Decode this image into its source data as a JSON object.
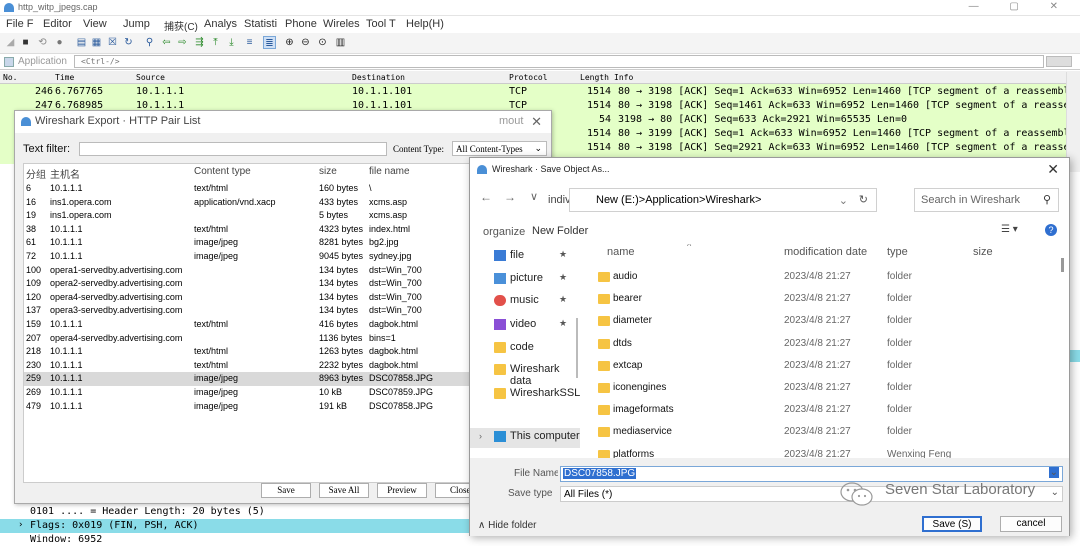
{
  "main": {
    "title": "http_witp_jpegs.cap",
    "menu": [
      "File F",
      "Editor",
      "View",
      "Jump",
      "捕获(C)",
      "Analys",
      "Statisti",
      "Phone",
      "Wireles",
      "Tool T",
      "Help(H)"
    ],
    "filter_label": "Application",
    "filter_placeholder": "<Ctrl-/>",
    "columns": [
      "No.",
      "Time",
      "Source",
      "Destination",
      "Protocol",
      "Length",
      "Info"
    ],
    "packets": [
      {
        "no": "246",
        "time": "6.767765",
        "src": "10.1.1.1",
        "dst": "10.1.1.101",
        "proto": "TCP",
        "len": "1514",
        "info": "80 → 3198 [ACK] Seq=1 Ack=633 Win=6952 Len=1460 [TCP segment of a reassembled PDU]"
      },
      {
        "no": "247",
        "time": "6.768985",
        "src": "10.1.1.1",
        "dst": "10.1.1.101",
        "proto": "TCP",
        "len": "1514",
        "info": "80 → 3198 [ACK] Seq=1461 Ack=633 Win=6952 Len=1460 [TCP segment of a reassembled PDU]"
      },
      {
        "no": "",
        "time": "",
        "src": "",
        "dst": "",
        "proto": "",
        "len": "54",
        "info": "3198 → 80 [ACK] Seq=633 Ack=2921 Win=65535 Len=0"
      },
      {
        "no": "",
        "time": "",
        "src": "",
        "dst": "",
        "proto": "",
        "len": "1514",
        "info": "80 → 3199 [ACK] Seq=1 Ack=633 Win=6952 Len=1460 [TCP segment of a reassembled PDU]"
      },
      {
        "no": "",
        "time": "",
        "src": "",
        "dst": "",
        "proto": "",
        "len": "1514",
        "info": "80 → 3198 [ACK] Seq=2921 Ack=633 Win=6952 Len=1460 [TCP segment of a reassembled PDU]"
      }
    ],
    "details": [
      "0101 .... = Header Length: 20 bytes (5)",
      "Flags: 0x019 (FIN, PSH, ACK)",
      "Window: 6952"
    ]
  },
  "export": {
    "title": "Wireshark Export · HTTP Pair List",
    "title_bg": "mout",
    "text_filter_label": "Text filter:",
    "content_type_label": "Content Type:",
    "content_type_value": "All Content-Types",
    "headers": [
      "分组",
      "主机名",
      "Content type",
      "size",
      "file name"
    ],
    "rows": [
      [
        "6",
        "10.1.1.1",
        "text/html",
        "160 bytes",
        "\\"
      ],
      [
        "16",
        "ins1.opera.com",
        "application/vnd.xacp",
        "433 bytes",
        "xcms.asp"
      ],
      [
        "19",
        "ins1.opera.com",
        "",
        "5 bytes",
        "xcms.asp"
      ],
      [
        "38",
        "10.1.1.1",
        "text/html",
        "4323 bytes",
        "index.html"
      ],
      [
        "61",
        "10.1.1.1",
        "image/jpeg",
        "8281 bytes",
        "bg2.jpg"
      ],
      [
        "72",
        "10.1.1.1",
        "image/jpeg",
        "9045 bytes",
        "sydney.jpg"
      ],
      [
        "100",
        "opera1-servedby.advertising.com",
        "",
        "134 bytes",
        "dst=Win_700"
      ],
      [
        "109",
        "opera2-servedby.advertising.com",
        "",
        "134 bytes",
        "dst=Win_700"
      ],
      [
        "120",
        "opera4-servedby.advertising.com",
        "",
        "134 bytes",
        "dst=Win_700"
      ],
      [
        "137",
        "opera3-servedby.advertising.com",
        "",
        "134 bytes",
        "dst=Win_700"
      ],
      [
        "159",
        "10.1.1.1",
        "text/html",
        "416 bytes",
        "dagbok.html"
      ],
      [
        "207",
        "opera4-servedby.advertising.com",
        "",
        "1136 bytes",
        "bins=1"
      ],
      [
        "218",
        "10.1.1.1",
        "text/html",
        "1263 bytes",
        "dagbok.html"
      ],
      [
        "230",
        "10.1.1.1",
        "text/html",
        "2232 bytes",
        "dagbok.html"
      ],
      [
        "259",
        "10.1.1.1",
        "image/jpeg",
        "8963 bytes",
        "DSC07858.JPG"
      ],
      [
        "269",
        "10.1.1.1",
        "image/jpeg",
        "10 kB",
        "DSC07859.JPG"
      ],
      [
        "479",
        "10.1.1.1",
        "image/jpeg",
        "191 kB",
        "DSC07858.JPG"
      ]
    ],
    "buttons": {
      "save": "Save",
      "save_all": "Save All",
      "preview": "Preview",
      "close": "Close"
    }
  },
  "save": {
    "title": "Wireshark · Save Object As...",
    "address_prefix": "individu",
    "address": "New (E:)>Application>Wireshark>",
    "search_placeholder": "Search in Wireshark",
    "organize": "organize",
    "new_folder": "New Folder",
    "nav": [
      {
        "label": "file",
        "icon": "download-icon",
        "color": "#3a7bd5",
        "pinned": true
      },
      {
        "label": "picture",
        "icon": "picture-icon",
        "color": "#4a90d9",
        "pinned": true
      },
      {
        "label": "music",
        "icon": "music-icon",
        "color": "#e2504a",
        "pinned": true
      },
      {
        "label": "video",
        "icon": "video-icon",
        "color": "#8a4fd6",
        "pinned": true
      },
      {
        "label": "code",
        "icon": "folder-icon",
        "color": "#f6c443",
        "pinned": false
      },
      {
        "label": "Wireshark data",
        "icon": "folder-icon",
        "color": "#f6c443",
        "pinned": false
      },
      {
        "label": "WiresharkSSL",
        "icon": "folder-icon",
        "color": "#f6c443",
        "pinned": false
      },
      {
        "label": "This computer",
        "icon": "computer-icon",
        "color": "#2b8fd6",
        "pinned": false
      }
    ],
    "columns": [
      "name",
      "modification date",
      "type",
      "size"
    ],
    "files": [
      {
        "name": "audio",
        "date": "2023/4/8 21:27",
        "type": "folder"
      },
      {
        "name": "bearer",
        "date": "2023/4/8 21:27",
        "type": "folder"
      },
      {
        "name": "diameter",
        "date": "2023/4/8 21:27",
        "type": "folder"
      },
      {
        "name": "dtds",
        "date": "2023/4/8 21:27",
        "type": "folder"
      },
      {
        "name": "extcap",
        "date": "2023/4/8 21:27",
        "type": "folder"
      },
      {
        "name": "iconengines",
        "date": "2023/4/8 21:27",
        "type": "folder"
      },
      {
        "name": "imageformats",
        "date": "2023/4/8 21:27",
        "type": "folder"
      },
      {
        "name": "mediaservice",
        "date": "2023/4/8 21:27",
        "type": "folder"
      },
      {
        "name": "platforms",
        "date": "2023/4/8 21:27",
        "type": "Wenxing Feng"
      }
    ],
    "file_name_label": "File Name:",
    "file_name_value": "DSC07858.JPG",
    "save_type_label": "Save type",
    "save_type_value": "All Files (*)",
    "hide_folder": "Hide folder",
    "save_button": "Save (S)",
    "cancel_button": "cancel"
  },
  "watermark": "Seven Star Laboratory",
  "colors": {
    "packet_row": "#e4ffc7",
    "selected_detail": "#8adce8",
    "accent": "#2f6fd0"
  }
}
